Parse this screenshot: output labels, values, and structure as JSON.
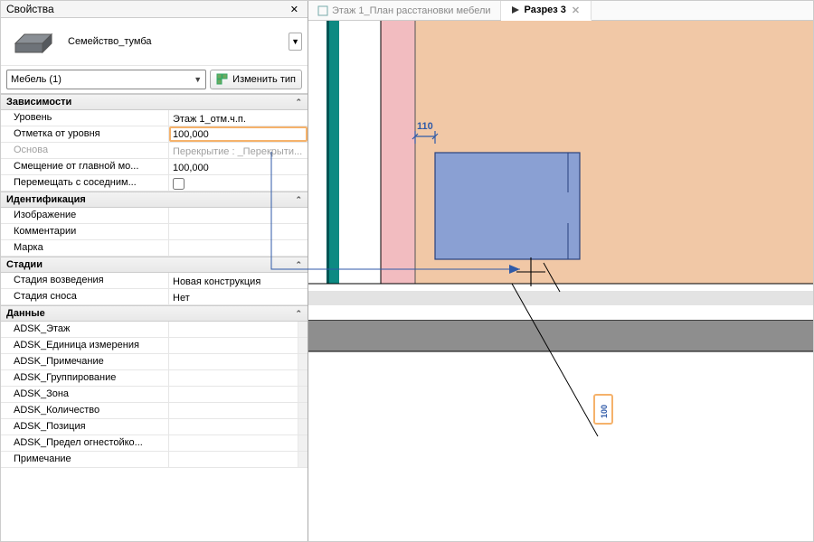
{
  "panel": {
    "title": "Свойства",
    "type_name": "Семейство_тумба",
    "family_selector": "Мебель (1)",
    "edit_type_label": "Изменить тип"
  },
  "groups": {
    "dependencies": {
      "label": "Зависимости",
      "rows": {
        "level": {
          "label": "Уровень",
          "value": "Этаж 1_отм.ч.п."
        },
        "offset": {
          "label": "Отметка от уровня",
          "value": "100,000"
        },
        "base": {
          "label": "Основа",
          "value": "Перекрытие : _Перекрыти..."
        },
        "main_offset": {
          "label": "Смещение от главной мо...",
          "value": "100,000"
        },
        "move_with": {
          "label": "Перемещать с соседним...",
          "checked": false
        }
      }
    },
    "identification": {
      "label": "Идентификация",
      "rows": {
        "image": {
          "label": "Изображение",
          "value": ""
        },
        "comments": {
          "label": "Комментарии",
          "value": ""
        },
        "mark": {
          "label": "Марка",
          "value": ""
        }
      }
    },
    "phasing": {
      "label": "Стадии",
      "rows": {
        "created": {
          "label": "Стадия возведения",
          "value": "Новая конструкция"
        },
        "demolished": {
          "label": "Стадия сноса",
          "value": "Нет"
        }
      }
    },
    "data": {
      "label": "Данные",
      "rows": {
        "r1": {
          "label": "ADSK_Этаж",
          "value": ""
        },
        "r2": {
          "label": "ADSK_Единица измерения",
          "value": ""
        },
        "r3": {
          "label": "ADSK_Примечание",
          "value": ""
        },
        "r4": {
          "label": "ADSK_Группирование",
          "value": ""
        },
        "r5": {
          "label": "ADSK_Зона",
          "value": ""
        },
        "r6": {
          "label": "ADSK_Количество",
          "value": ""
        },
        "r7": {
          "label": "ADSK_Позиция",
          "value": ""
        },
        "r8": {
          "label": "ADSK_Предел огнестойко...",
          "value": ""
        },
        "r9": {
          "label": "Примечание",
          "value": ""
        }
      }
    }
  },
  "tabs": {
    "tab1": "Этаж 1_План расстановки мебели",
    "tab2": "Разрез 3"
  },
  "chart_data": {
    "type": "section",
    "dimension_horizontal": "110",
    "elevation_mark": "100"
  }
}
